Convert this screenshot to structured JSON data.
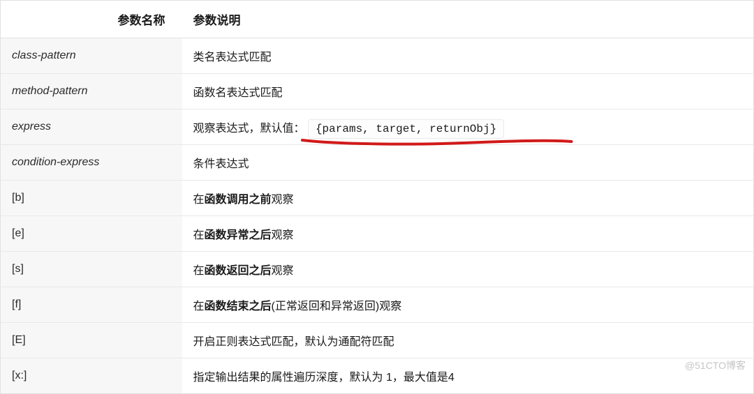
{
  "header": {
    "col1": "参数名称",
    "col2": "参数说明"
  },
  "rows": [
    {
      "name": "class-pattern",
      "name_style": "italic",
      "desc_parts": [
        {
          "text": "类名表达式匹配",
          "bold": false
        }
      ]
    },
    {
      "name": "method-pattern",
      "name_style": "italic",
      "desc_parts": [
        {
          "text": "函数名表达式匹配",
          "bold": false
        }
      ]
    },
    {
      "name": "express",
      "name_style": "italic",
      "desc_parts": [
        {
          "text": "观察表达式，默认值： ",
          "bold": false
        }
      ],
      "code": "{params, target, returnObj}",
      "underline": true
    },
    {
      "name": "condition-express",
      "name_style": "italic",
      "desc_parts": [
        {
          "text": "条件表达式",
          "bold": false
        }
      ]
    },
    {
      "name": "[b]",
      "name_style": "plain",
      "desc_parts": [
        {
          "text": "在",
          "bold": false
        },
        {
          "text": "函数调用之前",
          "bold": true
        },
        {
          "text": "观察",
          "bold": false
        }
      ]
    },
    {
      "name": "[e]",
      "name_style": "plain",
      "desc_parts": [
        {
          "text": "在",
          "bold": false
        },
        {
          "text": "函数异常之后",
          "bold": true
        },
        {
          "text": "观察",
          "bold": false
        }
      ]
    },
    {
      "name": "[s]",
      "name_style": "plain",
      "desc_parts": [
        {
          "text": "在",
          "bold": false
        },
        {
          "text": "函数返回之后",
          "bold": true
        },
        {
          "text": "观察",
          "bold": false
        }
      ]
    },
    {
      "name": "[f]",
      "name_style": "plain",
      "desc_parts": [
        {
          "text": "在",
          "bold": false
        },
        {
          "text": "函数结束之后",
          "bold": true
        },
        {
          "text": "(正常返回和异常返回)观察",
          "bold": false
        }
      ]
    },
    {
      "name": "[E]",
      "name_style": "plain",
      "desc_parts": [
        {
          "text": "开启正则表达式匹配，默认为通配符匹配",
          "bold": false
        }
      ]
    },
    {
      "name": "[x:]",
      "name_style": "plain",
      "desc_parts": [
        {
          "text": "指定输出结果的属性遍历深度，默认为 1，最大值是4",
          "bold": false
        }
      ]
    }
  ],
  "watermark": "@51CTO博客",
  "annotation": {
    "color": "#d11a1a"
  }
}
